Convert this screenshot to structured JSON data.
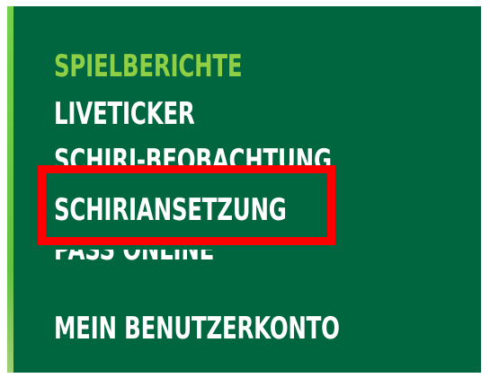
{
  "navigation": {
    "items": [
      {
        "label": "SPIELBERICHTE",
        "active": true
      },
      {
        "label": "LIVETICKER",
        "active": false
      },
      {
        "label": "SCHIRI-BEOBACHTUNG",
        "active": false
      },
      {
        "label": "SCHIRIANSETZUNG",
        "active": false
      },
      {
        "label": "PASS ONLINE",
        "active": false
      },
      {
        "label": "MEIN BENUTZERKONTO",
        "active": false
      }
    ]
  },
  "colors": {
    "panel_background": "#00663f",
    "active_text": "#8fcf45",
    "text": "#ffffff",
    "left_accent": "#73d14b",
    "highlight_border": "#ff0000"
  }
}
